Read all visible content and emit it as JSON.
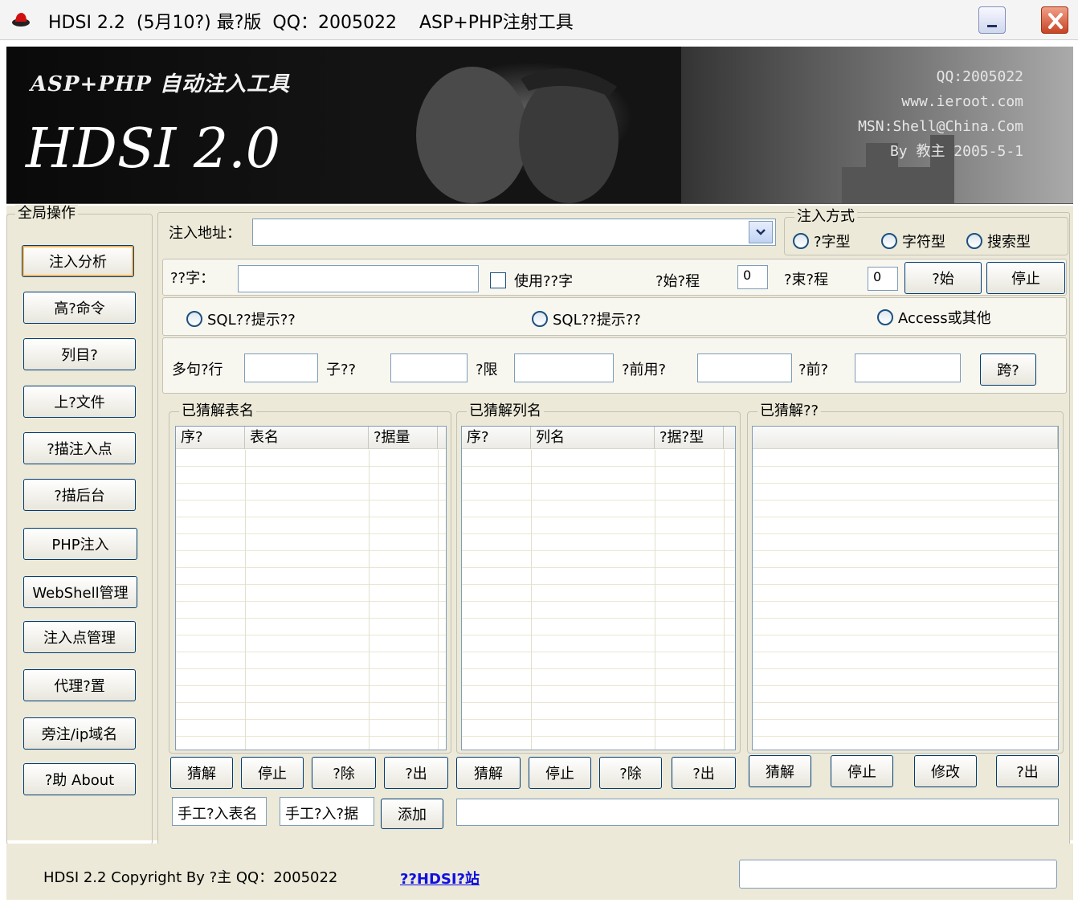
{
  "window": {
    "title": "HDSI 2.2  (5月10?) 最?版  QQ：2005022    ASP+PHP注射工具"
  },
  "banner": {
    "subtitle": "ASP+PHP 自动注入工具",
    "title": "HDSI 2.0",
    "info": [
      "QQ:2005022",
      "www.ieroot.com",
      "MSN:Shell@China.Com",
      "By 教主  2005-5-1"
    ]
  },
  "sidebar": {
    "legend": "全局操作",
    "items": [
      "注入分析",
      "高?命令",
      "列目?",
      "上?文件",
      "?描注入点",
      "?描后台",
      "PHP注入",
      "WebShell管理",
      "注入点管理",
      "代理?置",
      "旁注/ip域名",
      "?助 About"
    ]
  },
  "url_row": {
    "label": "注入地址：",
    "value": ""
  },
  "inject_mode": {
    "legend": "注入方式",
    "options": [
      "?字型",
      "字符型",
      "搜索型"
    ]
  },
  "keyword_row": {
    "label": "??字：",
    "value": "",
    "use_keyword": "使用??字",
    "start_thread_label": "?始?程",
    "start_thread": "0",
    "end_thread_label": "?束?程",
    "end_thread": "0",
    "start_button": "?始",
    "stop_button": "停止"
  },
  "db_type": {
    "options": [
      "SQL??提示??",
      "SQL??提示??",
      "Access或其他"
    ]
  },
  "param_row": {
    "labels": [
      "多句?行",
      "子??",
      "?限",
      "?前用?",
      "?前?"
    ],
    "button": "跨?"
  },
  "tables_panel": {
    "legend": "已猜解表名",
    "columns": [
      "序?",
      "表名",
      "?据量"
    ],
    "buttons": [
      "猜解",
      "停止",
      "?除",
      "?出"
    ]
  },
  "columns_panel": {
    "legend": "已猜解列名",
    "columns": [
      "序?",
      "列名",
      "?据?型"
    ],
    "buttons": [
      "猜解",
      "停止",
      "?除",
      "?出"
    ]
  },
  "data_panel": {
    "legend": "已猜解??",
    "buttons": [
      "猜解",
      "停止",
      "修改",
      "?出"
    ]
  },
  "manual_row": {
    "table_input": "手工?入表名",
    "data_input": "手工?入?据",
    "add_button": "添加",
    "output": ""
  },
  "statusbar": {
    "copyright": "HDSI 2.2  Copyright By ?主  QQ：2005022",
    "link": "??HDSI?站",
    "status": ""
  },
  "colors": {
    "face": "#ece9d8",
    "border": "#003c74",
    "link": "#1010e0"
  }
}
